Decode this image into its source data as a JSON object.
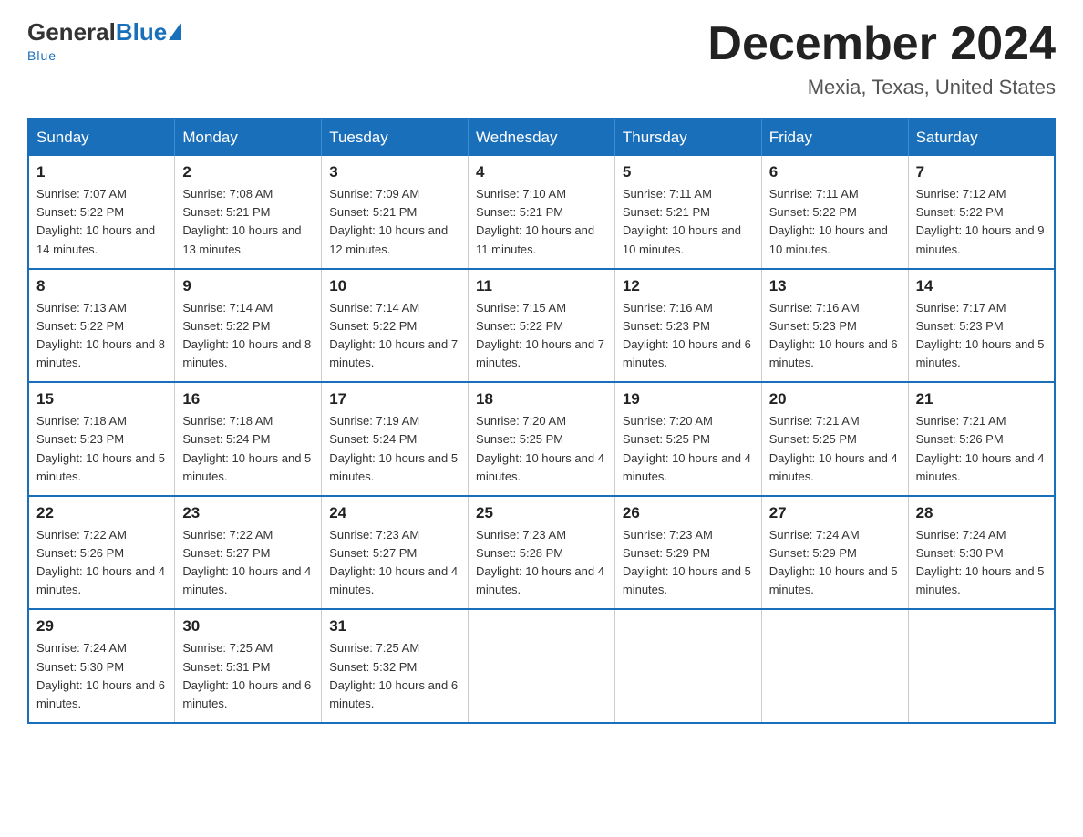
{
  "logo": {
    "general": "General",
    "blue": "Blue",
    "subtitle": "Blue"
  },
  "header": {
    "month_title": "December 2024",
    "location": "Mexia, Texas, United States"
  },
  "weekdays": [
    "Sunday",
    "Monday",
    "Tuesday",
    "Wednesday",
    "Thursday",
    "Friday",
    "Saturday"
  ],
  "weeks": [
    [
      {
        "day": "1",
        "sunrise": "7:07 AM",
        "sunset": "5:22 PM",
        "daylight": "10 hours and 14 minutes."
      },
      {
        "day": "2",
        "sunrise": "7:08 AM",
        "sunset": "5:21 PM",
        "daylight": "10 hours and 13 minutes."
      },
      {
        "day": "3",
        "sunrise": "7:09 AM",
        "sunset": "5:21 PM",
        "daylight": "10 hours and 12 minutes."
      },
      {
        "day": "4",
        "sunrise": "7:10 AM",
        "sunset": "5:21 PM",
        "daylight": "10 hours and 11 minutes."
      },
      {
        "day": "5",
        "sunrise": "7:11 AM",
        "sunset": "5:21 PM",
        "daylight": "10 hours and 10 minutes."
      },
      {
        "day": "6",
        "sunrise": "7:11 AM",
        "sunset": "5:22 PM",
        "daylight": "10 hours and 10 minutes."
      },
      {
        "day": "7",
        "sunrise": "7:12 AM",
        "sunset": "5:22 PM",
        "daylight": "10 hours and 9 minutes."
      }
    ],
    [
      {
        "day": "8",
        "sunrise": "7:13 AM",
        "sunset": "5:22 PM",
        "daylight": "10 hours and 8 minutes."
      },
      {
        "day": "9",
        "sunrise": "7:14 AM",
        "sunset": "5:22 PM",
        "daylight": "10 hours and 8 minutes."
      },
      {
        "day": "10",
        "sunrise": "7:14 AM",
        "sunset": "5:22 PM",
        "daylight": "10 hours and 7 minutes."
      },
      {
        "day": "11",
        "sunrise": "7:15 AM",
        "sunset": "5:22 PM",
        "daylight": "10 hours and 7 minutes."
      },
      {
        "day": "12",
        "sunrise": "7:16 AM",
        "sunset": "5:23 PM",
        "daylight": "10 hours and 6 minutes."
      },
      {
        "day": "13",
        "sunrise": "7:16 AM",
        "sunset": "5:23 PM",
        "daylight": "10 hours and 6 minutes."
      },
      {
        "day": "14",
        "sunrise": "7:17 AM",
        "sunset": "5:23 PM",
        "daylight": "10 hours and 5 minutes."
      }
    ],
    [
      {
        "day": "15",
        "sunrise": "7:18 AM",
        "sunset": "5:23 PM",
        "daylight": "10 hours and 5 minutes."
      },
      {
        "day": "16",
        "sunrise": "7:18 AM",
        "sunset": "5:24 PM",
        "daylight": "10 hours and 5 minutes."
      },
      {
        "day": "17",
        "sunrise": "7:19 AM",
        "sunset": "5:24 PM",
        "daylight": "10 hours and 5 minutes."
      },
      {
        "day": "18",
        "sunrise": "7:20 AM",
        "sunset": "5:25 PM",
        "daylight": "10 hours and 4 minutes."
      },
      {
        "day": "19",
        "sunrise": "7:20 AM",
        "sunset": "5:25 PM",
        "daylight": "10 hours and 4 minutes."
      },
      {
        "day": "20",
        "sunrise": "7:21 AM",
        "sunset": "5:25 PM",
        "daylight": "10 hours and 4 minutes."
      },
      {
        "day": "21",
        "sunrise": "7:21 AM",
        "sunset": "5:26 PM",
        "daylight": "10 hours and 4 minutes."
      }
    ],
    [
      {
        "day": "22",
        "sunrise": "7:22 AM",
        "sunset": "5:26 PM",
        "daylight": "10 hours and 4 minutes."
      },
      {
        "day": "23",
        "sunrise": "7:22 AM",
        "sunset": "5:27 PM",
        "daylight": "10 hours and 4 minutes."
      },
      {
        "day": "24",
        "sunrise": "7:23 AM",
        "sunset": "5:27 PM",
        "daylight": "10 hours and 4 minutes."
      },
      {
        "day": "25",
        "sunrise": "7:23 AM",
        "sunset": "5:28 PM",
        "daylight": "10 hours and 4 minutes."
      },
      {
        "day": "26",
        "sunrise": "7:23 AM",
        "sunset": "5:29 PM",
        "daylight": "10 hours and 5 minutes."
      },
      {
        "day": "27",
        "sunrise": "7:24 AM",
        "sunset": "5:29 PM",
        "daylight": "10 hours and 5 minutes."
      },
      {
        "day": "28",
        "sunrise": "7:24 AM",
        "sunset": "5:30 PM",
        "daylight": "10 hours and 5 minutes."
      }
    ],
    [
      {
        "day": "29",
        "sunrise": "7:24 AM",
        "sunset": "5:30 PM",
        "daylight": "10 hours and 6 minutes."
      },
      {
        "day": "30",
        "sunrise": "7:25 AM",
        "sunset": "5:31 PM",
        "daylight": "10 hours and 6 minutes."
      },
      {
        "day": "31",
        "sunrise": "7:25 AM",
        "sunset": "5:32 PM",
        "daylight": "10 hours and 6 minutes."
      },
      null,
      null,
      null,
      null
    ]
  ]
}
